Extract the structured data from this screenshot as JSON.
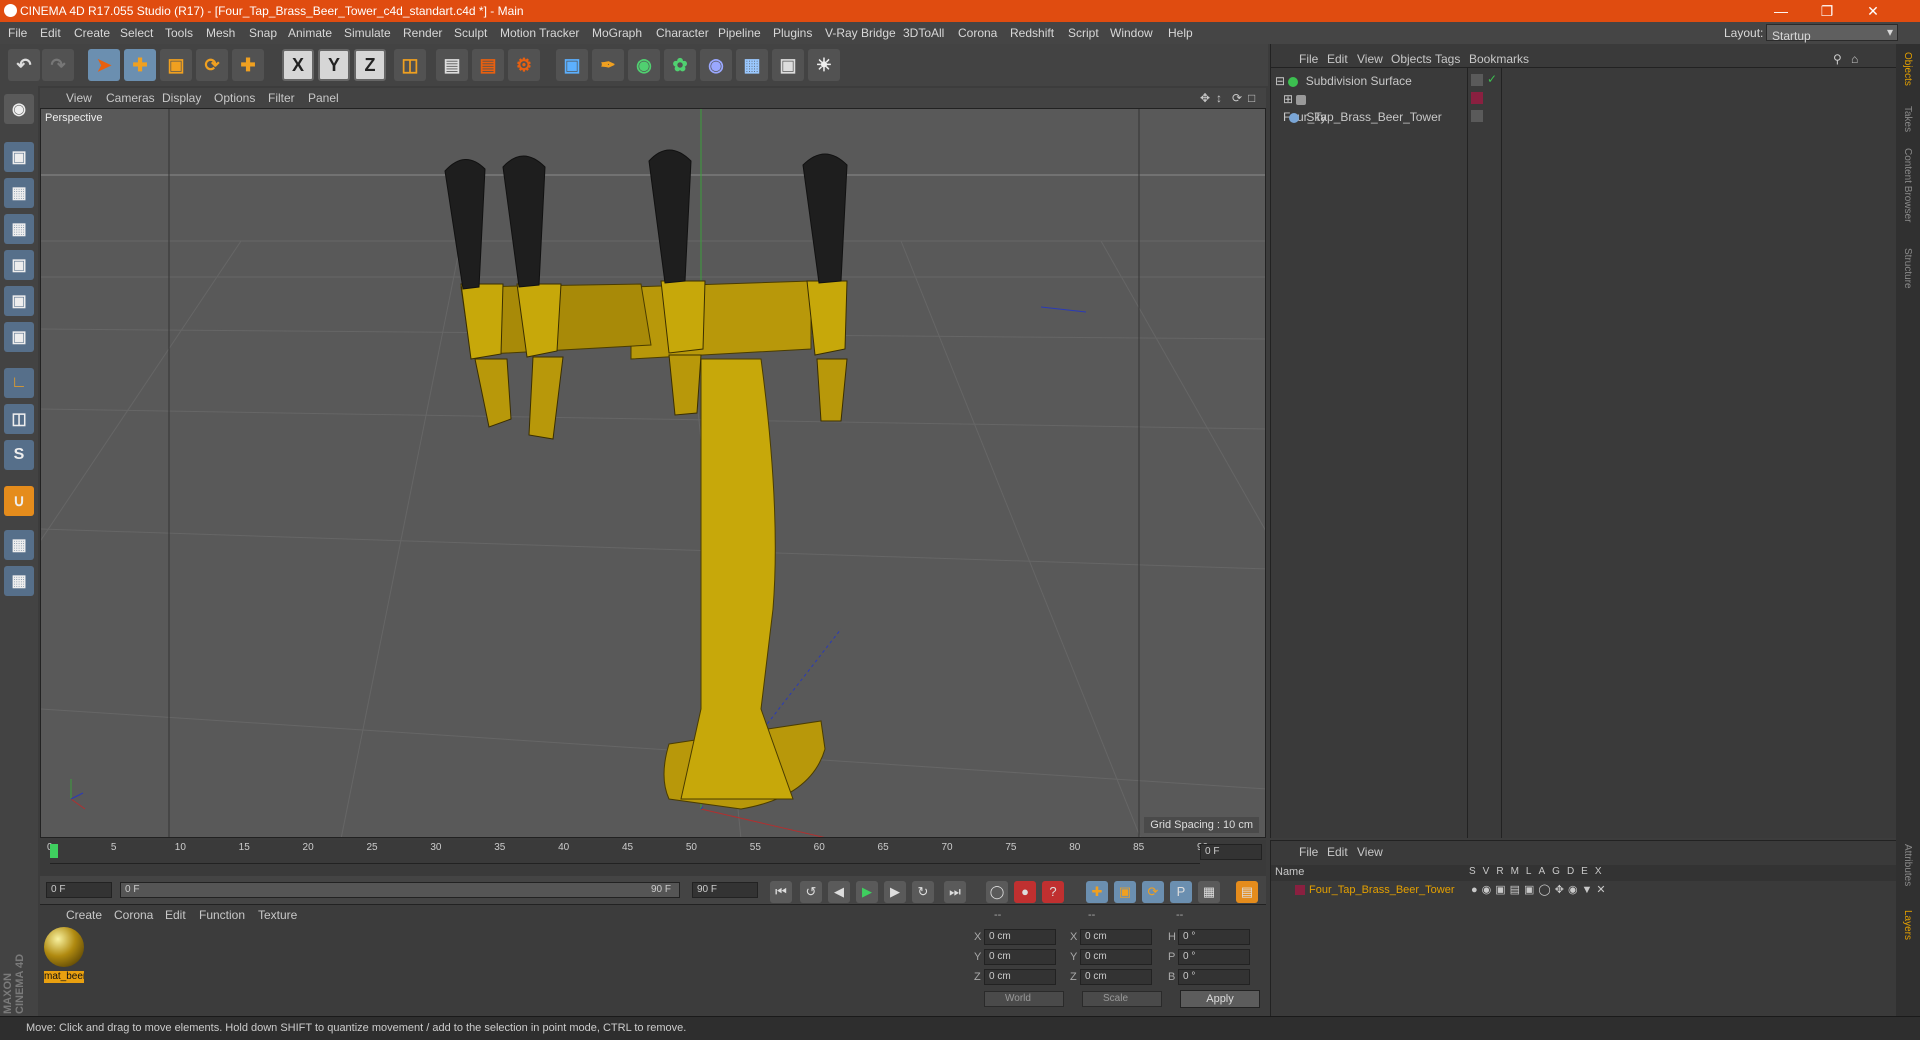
{
  "window": {
    "title": "CINEMA 4D R17.055 Studio (R17) - [Four_Tap_Brass_Beer_Tower_c4d_standart.c4d *] - Main"
  },
  "menubar": {
    "items": [
      "File",
      "Edit",
      "Create",
      "Select",
      "Tools",
      "Mesh",
      "Snap",
      "Animate",
      "Simulate",
      "Render",
      "Sculpt",
      "Motion Tracker",
      "MoGraph",
      "Character",
      "Pipeline",
      "Plugins",
      "V-Ray Bridge",
      "3DToAll",
      "Corona",
      "Redshift",
      "Script",
      "Window",
      "Help"
    ],
    "layout_label": "Layout:",
    "layout_value": "Startup"
  },
  "viewport": {
    "menu": [
      "View",
      "Cameras",
      "Display",
      "Options",
      "Filter",
      "Panel"
    ],
    "camera_label": "Perspective",
    "grid_spacing": "Grid Spacing : 10 cm"
  },
  "timeline": {
    "ticks": [
      "0",
      "5",
      "10",
      "15",
      "20",
      "25",
      "30",
      "35",
      "40",
      "45",
      "50",
      "55",
      "60",
      "65",
      "70",
      "75",
      "80",
      "85",
      "90"
    ],
    "end_field": "0 F",
    "current_frame": "0 F",
    "range_start": "0 F",
    "range_end": "90 F",
    "max_frame": "90 F"
  },
  "material_manager": {
    "menu": [
      "Create",
      "Corona",
      "Edit",
      "Function",
      "Texture"
    ],
    "materials": [
      {
        "name": "mat_beer"
      }
    ]
  },
  "coordinates": {
    "headers": [
      "--",
      "--",
      "--"
    ],
    "rows": [
      {
        "a_label": "X",
        "a_val": "0 cm",
        "b_label": "X",
        "b_val": "0 cm",
        "c_label": "H",
        "c_val": "0 °"
      },
      {
        "a_label": "Y",
        "a_val": "0 cm",
        "b_label": "Y",
        "b_val": "0 cm",
        "c_label": "P",
        "c_val": "0 °"
      },
      {
        "a_label": "Z",
        "a_val": "0 cm",
        "b_label": "Z",
        "b_val": "0 cm",
        "c_label": "B",
        "c_val": "0 °"
      }
    ],
    "mode_dropdown": "World",
    "size_dropdown": "Scale",
    "apply_label": "Apply"
  },
  "object_manager": {
    "menu": [
      "File",
      "Edit",
      "View",
      "Objects",
      "Tags",
      "Bookmarks"
    ],
    "objects": [
      {
        "name": "Subdivision Surface"
      },
      {
        "name": "Four_Tap_Brass_Beer_Tower"
      },
      {
        "name": "Sky"
      }
    ]
  },
  "layer_manager": {
    "menu": [
      "File",
      "Edit",
      "View"
    ],
    "name_header": "Name",
    "columns": [
      "S",
      "V",
      "R",
      "M",
      "L",
      "A",
      "G",
      "D",
      "E",
      "X"
    ],
    "layers": [
      {
        "name": "Four_Tap_Brass_Beer_Tower",
        "color": "#e4a000"
      }
    ]
  },
  "side_tabs": [
    "Objects",
    "Takes",
    "Content Browser",
    "Structure"
  ],
  "side_tabs_bottom": [
    "Attributes",
    "Layers"
  ],
  "branding": "MAXON CINEMA 4D",
  "status": "Move: Click and drag to move elements. Hold down SHIFT to quantize movement / add to the selection in point mode, CTRL to remove.",
  "colors": {
    "accent": "#e04c10",
    "brass": "#c7a80a",
    "selection": "#6b8fb0"
  }
}
